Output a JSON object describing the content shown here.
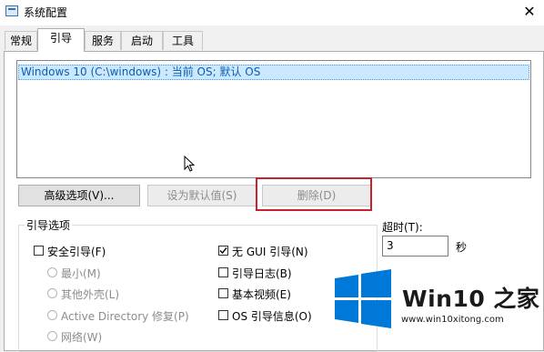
{
  "window": {
    "title": "系统配置",
    "close_glyph": "✕"
  },
  "tabs": [
    {
      "label": "常规",
      "active": false
    },
    {
      "label": "引导",
      "active": true
    },
    {
      "label": "服务",
      "active": false
    },
    {
      "label": "启动",
      "active": false
    },
    {
      "label": "工具",
      "active": false
    }
  ],
  "boot_list": {
    "items": [
      "Windows 10 (C:\\windows) : 当前 OS; 默认 OS"
    ],
    "selected_index": 0
  },
  "buttons": {
    "advanced": "高级选项(V)...",
    "set_default": "设为默认值(S)",
    "delete": "删除(D)"
  },
  "boot_options": {
    "title": "引导选项",
    "safe_boot": {
      "label": "安全引导(F)",
      "checked": false
    },
    "safe_modes": [
      "最小(M)",
      "其他外壳(L)",
      "Active Directory 修复(P)",
      "网络(W)"
    ],
    "no_gui": {
      "label": "无 GUI 引导(N)",
      "checked": true
    },
    "boot_log": {
      "label": "引导日志(B)",
      "checked": false
    },
    "base_video": {
      "label": "基本视频(E)",
      "checked": false
    },
    "os_info": {
      "label": "OS 引导信息(O)",
      "checked": false
    }
  },
  "timeout": {
    "label": "超时(T):",
    "value": "3",
    "unit": "秒"
  },
  "watermark": {
    "brand": "Win10 之家",
    "url": "www.win10xitong.com"
  },
  "colors": {
    "selection_bg": "#cce8ff",
    "selection_text": "#0a5fb4",
    "highlight": "#c8232c",
    "logo_blue": "#0078d7"
  },
  "icons": [
    "app-icon",
    "close-icon",
    "mouse-cursor-icon",
    "windows-logo-icon",
    "checkmark-icon"
  ]
}
